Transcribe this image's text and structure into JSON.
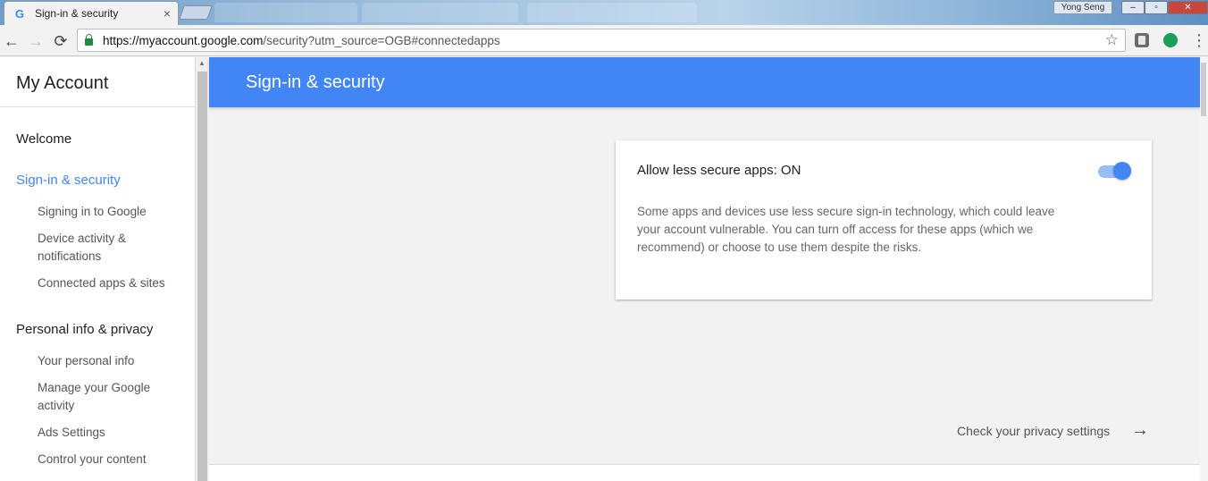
{
  "browser": {
    "tab_title": "Sign-in & security",
    "tab_favicon": "G",
    "tab_close": "×",
    "user_name": "Yong Seng",
    "url_scheme_host": "https://myaccount.google.com",
    "url_path": "/security?utm_source=OGB#connectedapps",
    "icons": {
      "back": "←",
      "forward": "→",
      "reload": "⟳",
      "star": "☆",
      "menu": "⋮",
      "minimize": "–",
      "maximize": "▫",
      "close": "✕"
    }
  },
  "sidebar": {
    "title": "My Account",
    "welcome": "Welcome",
    "signin_section": "Sign-in & security",
    "signin_items": [
      "Signing in to Google",
      "Device activity & notifications",
      "Connected apps & sites"
    ],
    "privacy_section": "Personal info & privacy",
    "privacy_items": [
      "Your personal info",
      "Manage your Google activity",
      "Ads Settings",
      "Control your content"
    ]
  },
  "main": {
    "header_title": "Sign-in & security",
    "card": {
      "title": "Allow less secure apps: ON",
      "toggle_on": true,
      "description": "Some apps and devices use less secure sign-in technology, which could leave your account vulnerable. You can turn off access for these apps (which we recommend) or choose to use them despite the risks."
    },
    "privacy_link": "Check your privacy settings",
    "privacy_arrow": "→"
  },
  "colors": {
    "accent": "#4285f4",
    "active_nav": "#4285f4",
    "close_button": "#c9463d"
  }
}
